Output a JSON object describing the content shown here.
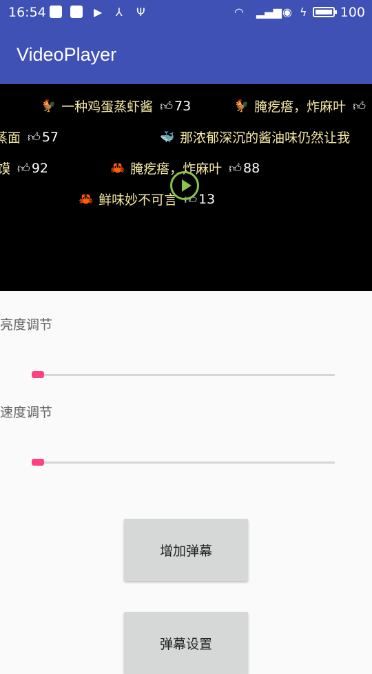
{
  "status_bar": {
    "time": "16:54",
    "battery_percent": "100",
    "left_icons": [
      "notification-icon",
      "gallery-icon",
      "video-icon",
      "usb-connection-icon",
      "usb-icon"
    ],
    "right_icons": [
      "wifi-icon",
      "signal-4g-icon",
      "hd-icon",
      "charging-icon",
      "battery-icon"
    ]
  },
  "app_bar": {
    "title": "VideoPlayer"
  },
  "video": {
    "danmaku": [
      {
        "emoji": "🐓",
        "text": "一种鸡蛋蒸虾酱",
        "likes": "73"
      },
      {
        "emoji": "🐓",
        "text": "腌疙瘩，炸麻叶",
        "likes": ""
      },
      {
        "emoji": "",
        "text": "蒸面",
        "likes": "57"
      },
      {
        "emoji": "🐳",
        "text": "那浓郁深沉的酱油味仍然让我",
        "likes": ""
      },
      {
        "emoji": "",
        "text": "馍",
        "likes": "92"
      },
      {
        "emoji": "🦀",
        "text": "腌疙瘩，炸麻叶",
        "likes": "88"
      },
      {
        "emoji": "🦀",
        "text": "鲜味妙不可言",
        "likes": "13"
      }
    ],
    "accent_color": "#8bc34a"
  },
  "brightness": {
    "label": "亮度调节",
    "value": 0.02
  },
  "speed": {
    "label": "速度调节",
    "value": 0.02
  },
  "buttons": {
    "add_danmaku": "增加弹幕",
    "danmaku_settings": "弹幕设置"
  },
  "colors": {
    "primary": "#3f51b5",
    "accent": "#ff4081",
    "danmaku_text": "#f6e9a4"
  }
}
